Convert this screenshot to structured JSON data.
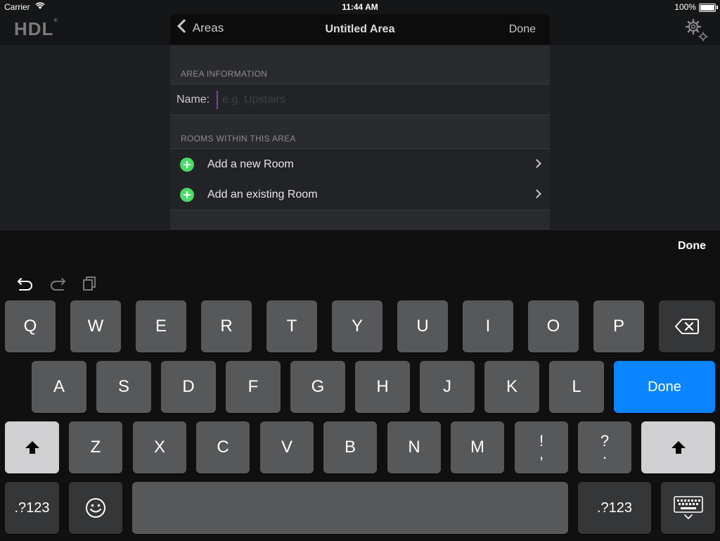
{
  "status": {
    "carrier": "Carrier",
    "time": "11:44 AM",
    "battery": "100%"
  },
  "app": {
    "logo": "HDL",
    "logo_mark": "®",
    "settings_icon": "gear-icon"
  },
  "nav": {
    "back_label": "Areas",
    "title": "Untitled Area",
    "done_label": "Done"
  },
  "area_info": {
    "header": "AREA INFORMATION",
    "name_label": "Name:",
    "name_value": "",
    "name_placeholder": "e.g. Upstairs"
  },
  "rooms": {
    "header": "ROOMS WITHIN THIS AREA",
    "items": [
      {
        "label": "Add a new Room"
      },
      {
        "label": "Add an existing Room"
      }
    ]
  },
  "keyboard": {
    "done_label": "Done",
    "row1": [
      "Q",
      "W",
      "E",
      "R",
      "T",
      "Y",
      "U",
      "I",
      "O",
      "P"
    ],
    "row2": [
      "A",
      "S",
      "D",
      "F",
      "G",
      "H",
      "J",
      "K",
      "L"
    ],
    "return_label": "Done",
    "row3": [
      "Z",
      "X",
      "C",
      "V",
      "B",
      "N",
      "M"
    ],
    "punct1": {
      "top": "!",
      "bottom": ","
    },
    "punct2": {
      "top": "?",
      "bottom": "."
    },
    "numbers_label": ".?123",
    "colors": {
      "accent": "#0a84ff",
      "add_green": "#4cd964",
      "cursor": "#8a3cb8"
    }
  }
}
